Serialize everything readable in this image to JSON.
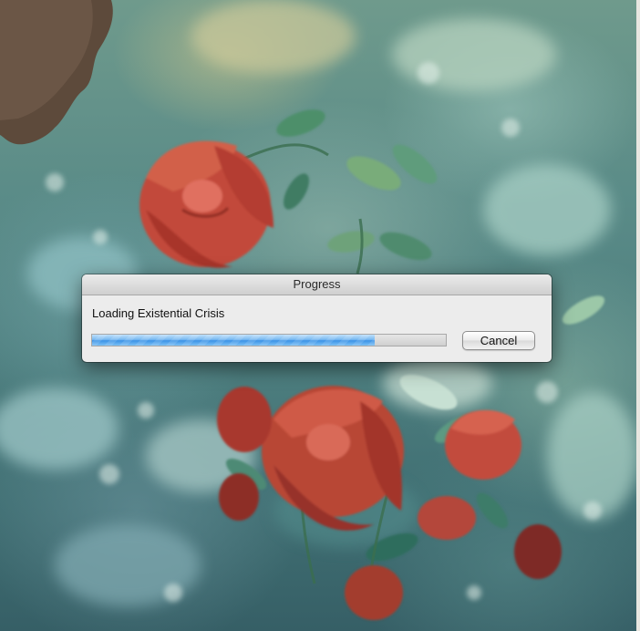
{
  "dialog": {
    "title": "Progress",
    "message": "Loading Existential Crisis",
    "progress": 0.8,
    "cancel_label": "Cancel"
  },
  "background": {
    "description_icon": "rose-photo-background"
  },
  "colors": {
    "progress_blue": "#3c93e6",
    "window_bg": "#ececec"
  }
}
